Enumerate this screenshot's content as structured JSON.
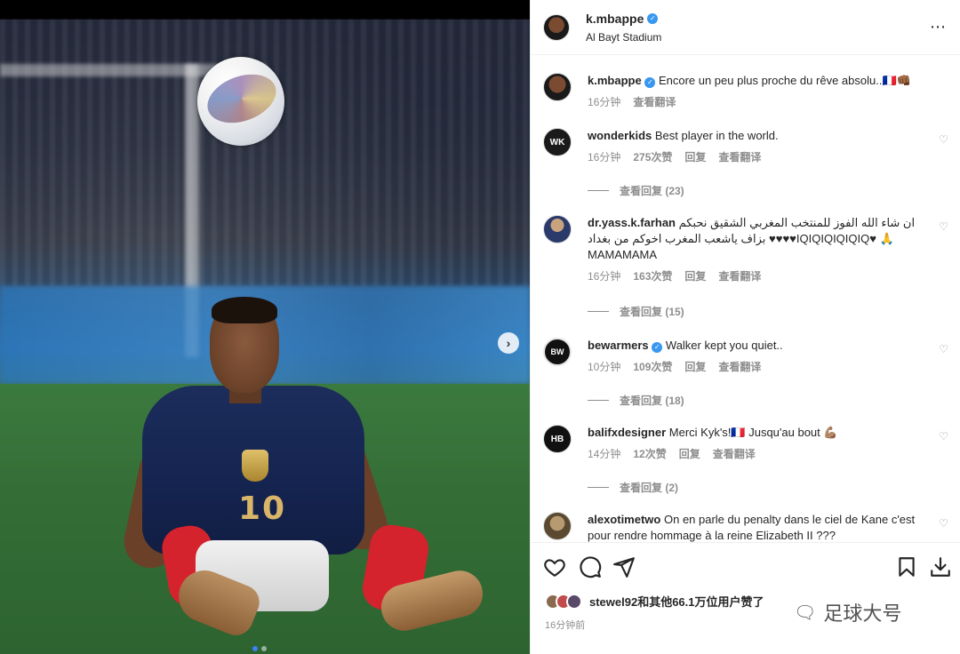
{
  "post": {
    "username": "k.mbappe",
    "location": "Al Bayt Stadium",
    "more_icon": "⋯"
  },
  "caption": {
    "username": "k.mbappe",
    "text": "Encore un peu plus proche du rêve absolu..🇫🇷👊🏾",
    "time": "16分钟",
    "translate": "查看翻译"
  },
  "comments": [
    {
      "username": "wonderkids",
      "avatar_text": "WK",
      "text": "Best player in the world.",
      "time": "16分钟",
      "likes": "275次赞",
      "reply": "回复",
      "translate": "查看翻译",
      "replies": "查看回复 (23)"
    },
    {
      "username": "dr.yass.k.farhan",
      "text": "ان شاء الله الفوز للمنتخب المغربي الشقيق نحبكم بزاف ياشعب المغرب اخوكم من بغداد ♥♥♥♥IQIQIQIQIQIQ♥ 🙏 MAMAMAMA",
      "time": "16分钟",
      "likes": "163次赞",
      "reply": "回复",
      "translate": "查看翻译",
      "replies": "查看回复 (15)"
    },
    {
      "username": "bewarmers",
      "avatar_text": "BW",
      "text": "Walker kept you quiet..",
      "time": "10分钟",
      "likes": "109次赞",
      "reply": "回复",
      "translate": "查看翻译",
      "replies": "查看回复 (18)"
    },
    {
      "username": "balifxdesigner",
      "avatar_text": "HB",
      "text": "Merci Kyk's!🇫🇷 Jusqu'au bout 💪🏽",
      "time": "14分钟",
      "likes": "12次赞",
      "reply": "回复",
      "translate": "查看翻译",
      "replies": "查看回复 (2)"
    },
    {
      "username": "alexotimetwo",
      "text": "On en parle du penalty dans le ciel de Kane c'est pour rendre hommage à la reine Elizabeth II ???"
    }
  ],
  "footer": {
    "likes_user": "stewel92",
    "likes_rest": "和其他66.1万位用户赞了",
    "time": "16分钟前",
    "watermark": "足球大号"
  },
  "colors": {
    "verified": "#3897f0",
    "text": "#262626",
    "muted": "#8e8e8e",
    "border": "#efefef"
  }
}
